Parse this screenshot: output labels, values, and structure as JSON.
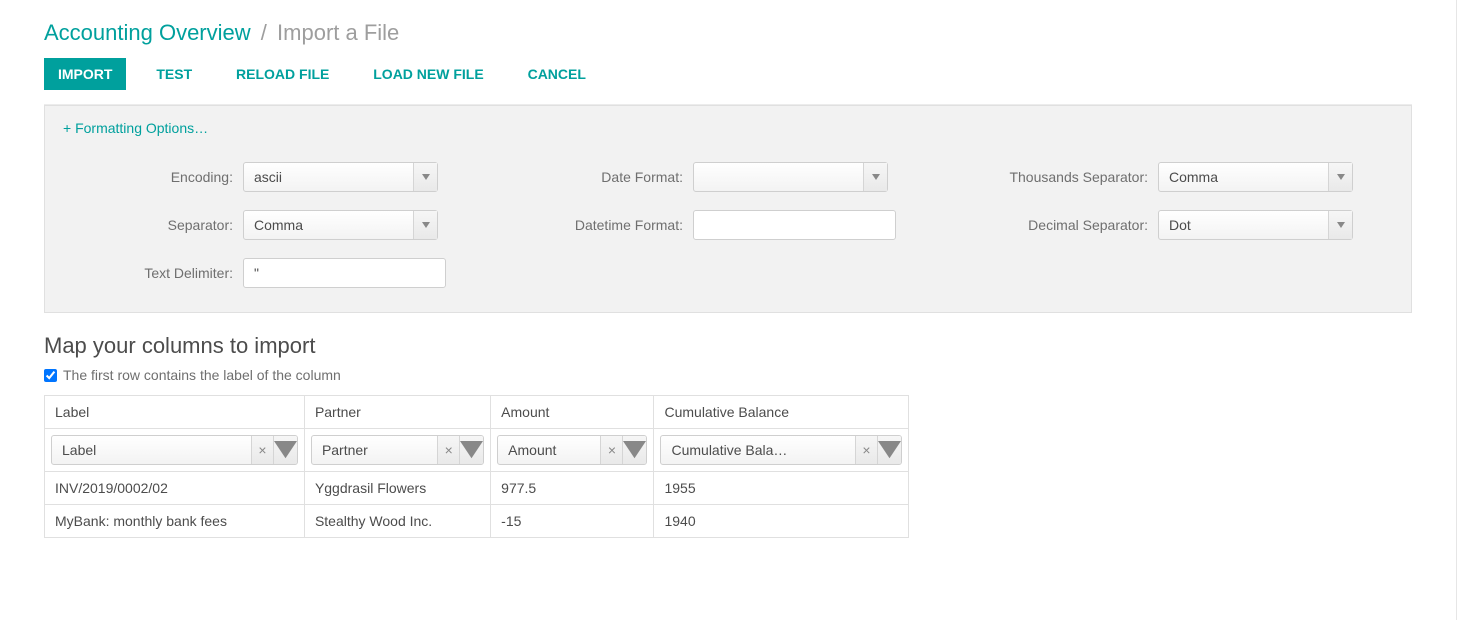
{
  "breadcrumb": {
    "parent": "Accounting Overview",
    "separator": "/",
    "current": "Import a File"
  },
  "actions": {
    "import": "IMPORT",
    "test": "TEST",
    "reload": "RELOAD FILE",
    "load_new": "LOAD NEW FILE",
    "cancel": "CANCEL"
  },
  "formatting": {
    "toggle_label": "+ Formatting Options…",
    "encoding_label": "Encoding:",
    "encoding_value": "ascii",
    "separator_label": "Separator:",
    "separator_value": "Comma",
    "text_delimiter_label": "Text Delimiter:",
    "text_delimiter_value": "\"",
    "date_format_label": "Date Format:",
    "date_format_value": "",
    "datetime_format_label": "Datetime Format:",
    "datetime_format_value": "",
    "thousands_sep_label": "Thousands Separator:",
    "thousands_sep_value": "Comma",
    "decimal_sep_label": "Decimal Separator:",
    "decimal_sep_value": "Dot"
  },
  "mapping": {
    "title": "Map your columns to import",
    "first_row_label": "The first row contains the label of the column",
    "first_row_checked": true,
    "columns": [
      {
        "header": "Label",
        "mapped": "Label"
      },
      {
        "header": "Partner",
        "mapped": "Partner"
      },
      {
        "header": "Amount",
        "mapped": "Amount"
      },
      {
        "header": "Cumulative Balance",
        "mapped": "Cumulative Bala…"
      }
    ],
    "rows": [
      [
        "INV/2019/0002/02",
        "Yggdrasil Flowers",
        "977.5",
        "1955"
      ],
      [
        "MyBank: monthly bank fees",
        "Stealthy Wood Inc.",
        "-15",
        "1940"
      ]
    ]
  }
}
